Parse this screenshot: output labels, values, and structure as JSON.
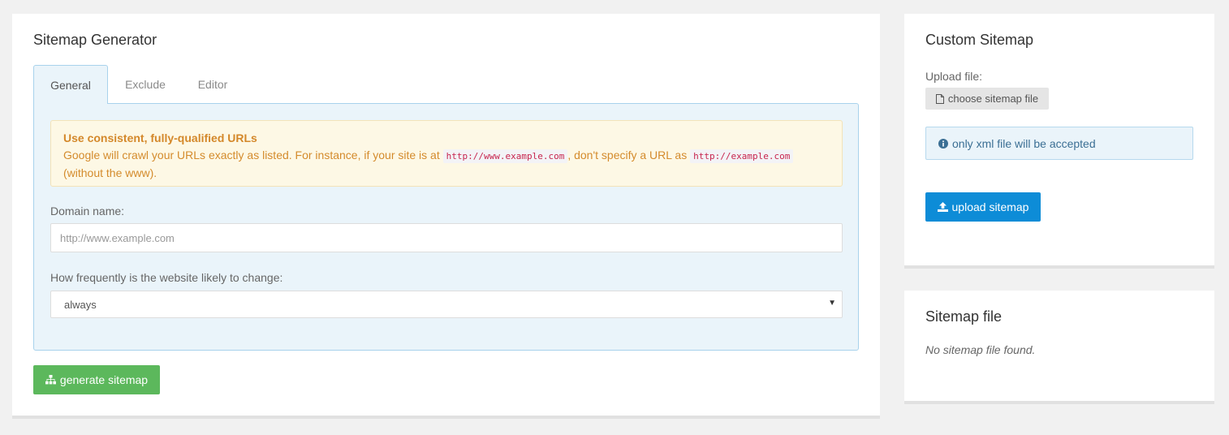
{
  "generator": {
    "title": "Sitemap Generator",
    "tabs": [
      {
        "label": "General",
        "active": true
      },
      {
        "label": "Exclude",
        "active": false
      },
      {
        "label": "Editor",
        "active": false
      }
    ],
    "alert": {
      "heading": "Use consistent, fully-qualified URLs",
      "text_before": "Google will crawl your URLs exactly as listed. For instance, if your site is at ",
      "code1": "http://www.example.com",
      "text_middle": ", don't specify a URL as ",
      "code2": "http://example.com",
      "text_after": "(without the www)."
    },
    "domain_label": "Domain name:",
    "domain_placeholder": "http://www.example.com",
    "domain_value": "",
    "frequency_label": "How frequently is the website likely to change:",
    "frequency_selected": "always",
    "generate_button": "generate sitemap"
  },
  "custom": {
    "title": "Custom Sitemap",
    "upload_label": "Upload file:",
    "choose_button": "choose sitemap file",
    "info_text": "only xml file will be accepted",
    "upload_button": "upload sitemap"
  },
  "sitemap_file": {
    "title": "Sitemap file",
    "empty_text": "No sitemap file found."
  },
  "colors": {
    "green": "#5cb85c",
    "blue": "#0d8cd7",
    "warning": "#d48b2c",
    "info_bg": "#eaf4fa"
  }
}
